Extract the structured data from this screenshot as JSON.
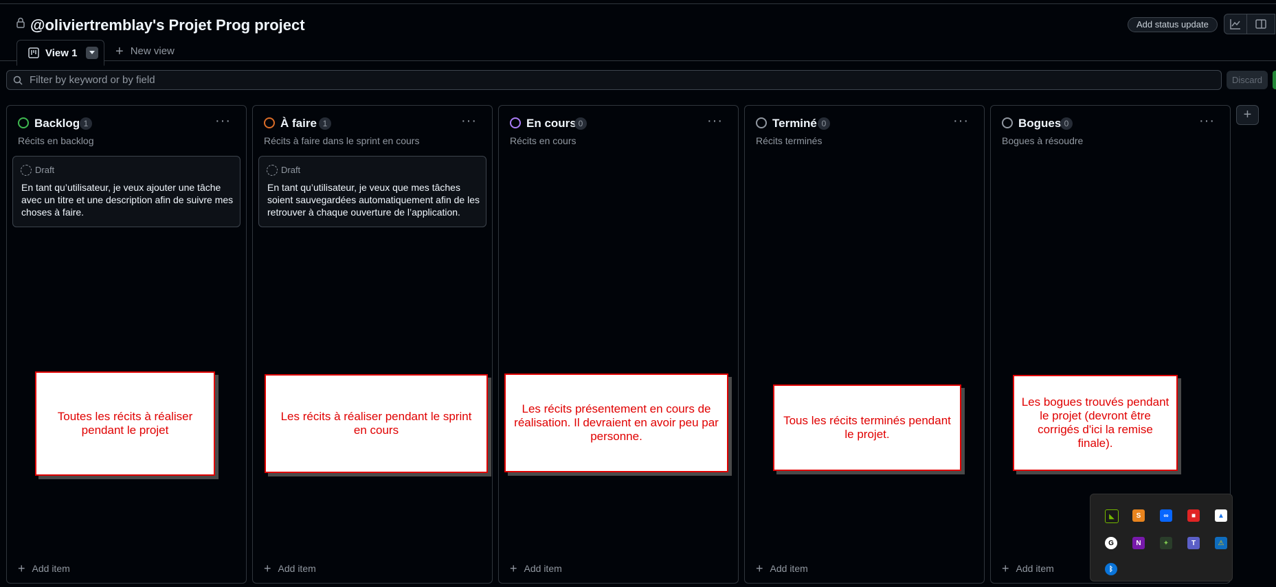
{
  "project": {
    "title": "@oliviertremblay's Projet Prog project"
  },
  "header": {
    "status_update": "Add status update"
  },
  "tabs": {
    "active_label": "View 1",
    "new_view": "New view"
  },
  "filter": {
    "placeholder": "Filter by keyword or by field",
    "discard": "Discard"
  },
  "columns": [
    {
      "name": "Backlog",
      "count": "1",
      "description": "Récits en backlog",
      "color": "#3fb950",
      "card": {
        "status": "Draft",
        "text": "En tant qu’utilisateur, je veux ajouter une tâche avec un titre et une description afin de suivre mes choses à faire."
      },
      "add": "Add item"
    },
    {
      "name": "À faire",
      "count": "1",
      "description": "Récits à faire dans le sprint en cours",
      "color": "#db6d28",
      "card": {
        "status": "Draft",
        "text": "En tant qu’utilisateur, je veux que mes tâches soient sauvegardées automatiquement afin de les retrouver à chaque ouverture de l’application."
      },
      "add": "Add item"
    },
    {
      "name": "En cours",
      "count": "0",
      "description": "Récits en cours",
      "color": "#ab7df8",
      "add": "Add item"
    },
    {
      "name": "Terminé",
      "count": "0",
      "description": "Récits terminés",
      "color": "#9198a1",
      "add": "Add item"
    },
    {
      "name": "Bogues",
      "count": "0",
      "description": "Bogues à résoudre",
      "color": "#9198a1",
      "add": "Add item"
    }
  ],
  "notes": [
    "Toutes les récits à réaliser pendant le projet",
    "Les récits à réaliser pendant le sprint en cours",
    "Les récits présentement en cours de réalisation. Il devraient en avoir peu par personne.",
    "Tous les récits terminés pendant le projet.",
    "Les bogues trouvés pendant le projet (devront être corrigés d'ici la remise finale)."
  ],
  "tray_icons": [
    "nvidia-icon",
    "sublime-icon",
    "meta-icon",
    "stop-icon",
    "drive-icon",
    "logitech-icon",
    "onenote-icon",
    "game-icon",
    "teams-icon",
    "defender-icon",
    "bluetooth-icon"
  ]
}
